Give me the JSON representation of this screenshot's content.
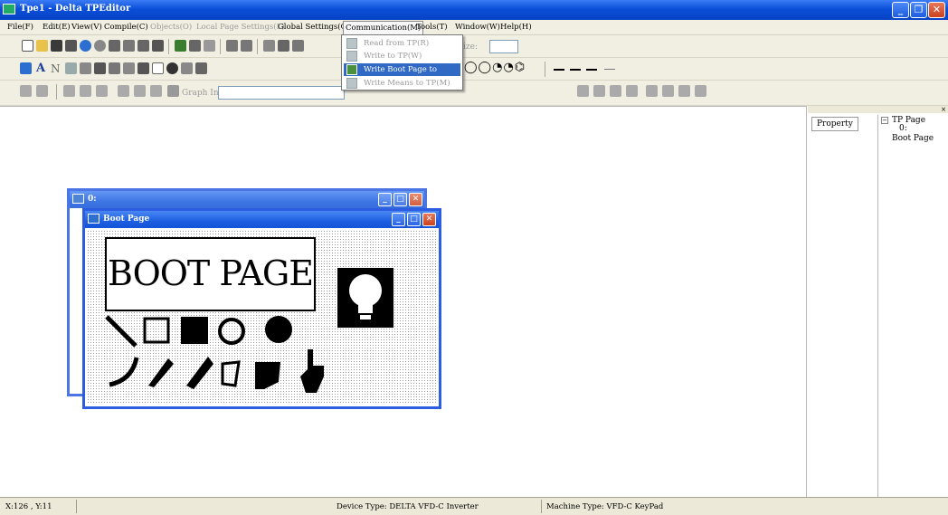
{
  "window": {
    "title": "Tpe1 - Delta TPEditor"
  },
  "menubar": {
    "items": [
      {
        "label": "File(F)",
        "enabled": true
      },
      {
        "label": "Edit(E)",
        "enabled": true
      },
      {
        "label": "View(V)",
        "enabled": true
      },
      {
        "label": "Compile(C)",
        "enabled": true
      },
      {
        "label": "Objects(O)",
        "enabled": false
      },
      {
        "label": "Local Page Settings(L)",
        "enabled": false
      },
      {
        "label": "Global Settings(G)",
        "enabled": true
      },
      {
        "label": "Communication(M)",
        "enabled": true,
        "open": true
      },
      {
        "label": "Tools(T)",
        "enabled": true
      },
      {
        "label": "Window(W)",
        "enabled": true
      },
      {
        "label": "Help(H)",
        "enabled": true
      }
    ]
  },
  "communication_menu": {
    "items": [
      {
        "label": "Read from TP(R)",
        "enabled": false,
        "icon": "read-from-tp-icon"
      },
      {
        "label": "Write to TP(W)",
        "enabled": false,
        "icon": "write-to-tp-icon"
      },
      {
        "label": "Write Boot Page to TP(B)",
        "enabled": true,
        "highlighted": true,
        "icon": "write-boot-page-icon"
      },
      {
        "label": "Write Means to TP(M)",
        "enabled": false,
        "icon": "write-means-icon"
      }
    ]
  },
  "toolbar1": {
    "size_label": "ize:",
    "size_value": ""
  },
  "toolbar3": {
    "graph_input_label": "Graph Input"
  },
  "mdi_back": {
    "title": "0:"
  },
  "mdi_front": {
    "title": "Boot Page",
    "boot_text": "BOOT PAGE"
  },
  "right_panel": {
    "property_tab": "Property",
    "tree": {
      "root": "TP Page",
      "children": [
        "0:",
        "Boot Page"
      ]
    }
  },
  "status_bar": {
    "coords": "X:126 , Y:11",
    "device_type": "Device Type: DELTA VFD-C Inverter",
    "machine_type": "Machine Type: VFD-C KeyPad"
  },
  "colors": {
    "titlebar": "#0a4fd8",
    "chrome": "#f1efe2",
    "highlight": "#316ac5",
    "mdi_border": "#2c5de0"
  }
}
